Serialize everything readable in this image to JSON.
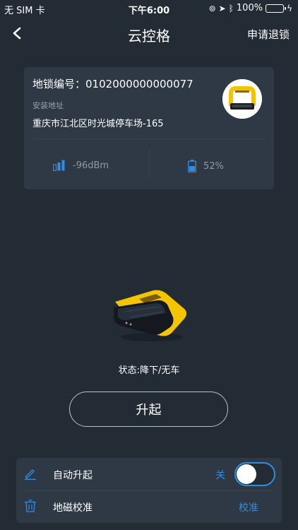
{
  "status_bar": {
    "carrier": "无 SIM 卡",
    "time": "下午6:00",
    "battery_percent": "100%",
    "battery_level": 1.0
  },
  "nav": {
    "title": "云控格",
    "action": "申请退锁"
  },
  "lock_info": {
    "number_label": "地锁编号：",
    "number": "0102000000000077",
    "address_label": "安装地址",
    "address": "重庆市江北区时光城停车场-165",
    "signal": "-96dBm",
    "battery": "52%",
    "battery_level": 0.52
  },
  "device": {
    "status": "状态:降下/无车"
  },
  "actions": {
    "raise": "升起"
  },
  "settings": {
    "auto_raise_label": "自动升起",
    "auto_raise_state": "关",
    "auto_raise_on": false,
    "calibrate_label": "地磁校准",
    "calibrate_action": "校准"
  },
  "colors": {
    "background": "#232b35",
    "card": "#2f3946",
    "accent": "#2e8ee6",
    "lock_yellow": "#f5c400"
  },
  "icons": {
    "back": "chevron-left-icon",
    "signal": "signal-bars-icon",
    "battery": "battery-icon",
    "auto_raise": "pen-icon",
    "calibrate": "trash-bin-icon"
  }
}
